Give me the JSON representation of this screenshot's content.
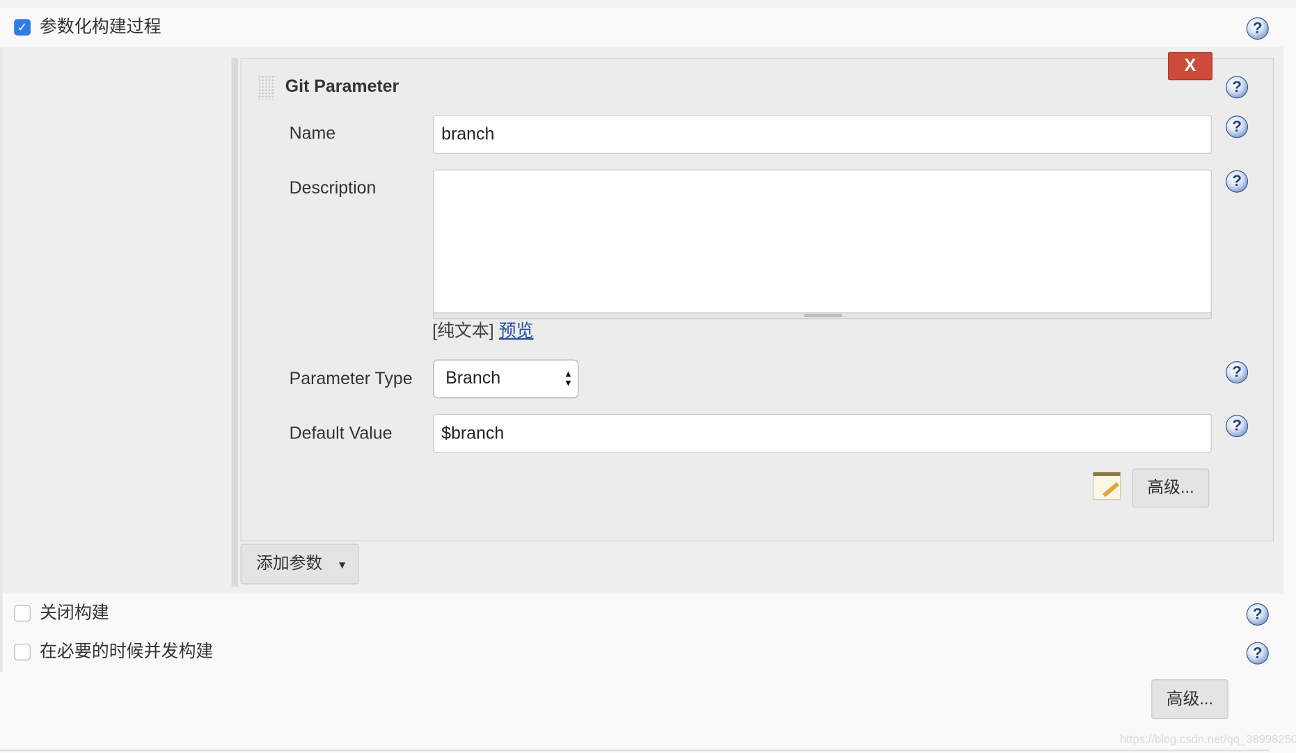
{
  "parameterized": {
    "label": "参数化构建过程",
    "checked": true
  },
  "git_parameter": {
    "title": "Git Parameter",
    "delete_label": "X",
    "name": {
      "label": "Name",
      "value": "branch"
    },
    "description": {
      "label": "Description",
      "value": "",
      "plain_text": "[纯文本]",
      "preview": "预览"
    },
    "parameter_type": {
      "label": "Parameter Type",
      "value": "Branch"
    },
    "default_value": {
      "label": "Default Value",
      "value": "$branch"
    },
    "advanced_label": "高级..."
  },
  "add_parameter_label": "添加参数",
  "disable_build": {
    "label": "关闭构建",
    "checked": false
  },
  "concurrent_build": {
    "label": "在必要的时候并发构建",
    "checked": false
  },
  "advanced_label": "高级...",
  "watermark": "https://blog.csdn.net/qq_38998250",
  "colors": {
    "delete": "#cc4b3b",
    "checkbox": "#2d7be5",
    "link": "#2a4f9c"
  }
}
